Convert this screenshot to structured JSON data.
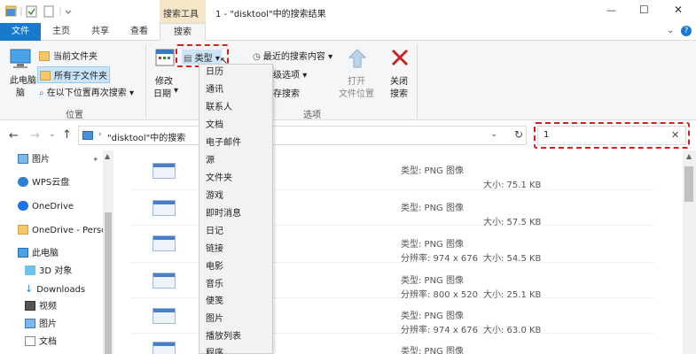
{
  "window": {
    "title": "1 - \"disktool\"中的搜索结果",
    "context_tab": "搜索工具",
    "controls": {
      "minimize": "—",
      "maximize": "☐",
      "close": "✕"
    }
  },
  "tabs": [
    "文件",
    "主页",
    "共享",
    "查看",
    "搜索"
  ],
  "ribbon": {
    "this_pc": "此电脑",
    "this_pc_line2": "脑",
    "location": {
      "current_folder": "当前文件夹",
      "all_subfolders": "所有子文件夹",
      "search_again": "在以下位置再次搜索",
      "group_label": "位置"
    },
    "refine": {
      "date_modified_line1": "修改",
      "date_modified_line2": "日期",
      "kind": "类型",
      "recent_searches": "最近的搜索内容",
      "advanced": "级选项",
      "save_search": "存搜索",
      "open_location_line1": "打开",
      "open_location_line2": "文件位置",
      "close_search_line1": "关闭",
      "close_search_line2": "搜索",
      "group_label": "选项"
    }
  },
  "kind_menu": {
    "items": [
      "日历",
      "通讯",
      "联系人",
      "文档",
      "电子邮件",
      "源",
      "文件夹",
      "游戏",
      "即时消息",
      "日记",
      "链接",
      "电影",
      "音乐",
      "便笺",
      "图片",
      "播放列表",
      "程序"
    ]
  },
  "address": {
    "path": "\"disktool\"中的搜索",
    "search_value": "1"
  },
  "nav": {
    "items": [
      "图片",
      "WPS云盘",
      "OneDrive",
      "OneDrive - Perso",
      "此电脑",
      "3D 对象",
      "Downloads",
      "视频",
      "图片",
      "文档"
    ]
  },
  "results": [
    {
      "type": "类型: PNG 图像",
      "res": "",
      "size": "大小: 75.1 KB"
    },
    {
      "type": "类型: PNG 图像",
      "res": "",
      "size": "大小: 57.5 KB"
    },
    {
      "type": "类型: PNG 图像",
      "res": "分辨率: 974 x 676",
      "size": "大小: 54.5 KB"
    },
    {
      "type": "类型: PNG 图像",
      "res": "分辨率: 800 x 520",
      "size": "大小: 25.1 KB"
    },
    {
      "type": "类型: PNG 图像",
      "res": "分辨率: 974 x 676",
      "size": "大小: 63.0 KB"
    },
    {
      "type": "类型: PNG 图像",
      "res": "",
      "size": ""
    }
  ],
  "colors": {
    "accent": "#1979ca",
    "annotation": "#d42020",
    "context_tab_bg": "#f6e6c8"
  }
}
